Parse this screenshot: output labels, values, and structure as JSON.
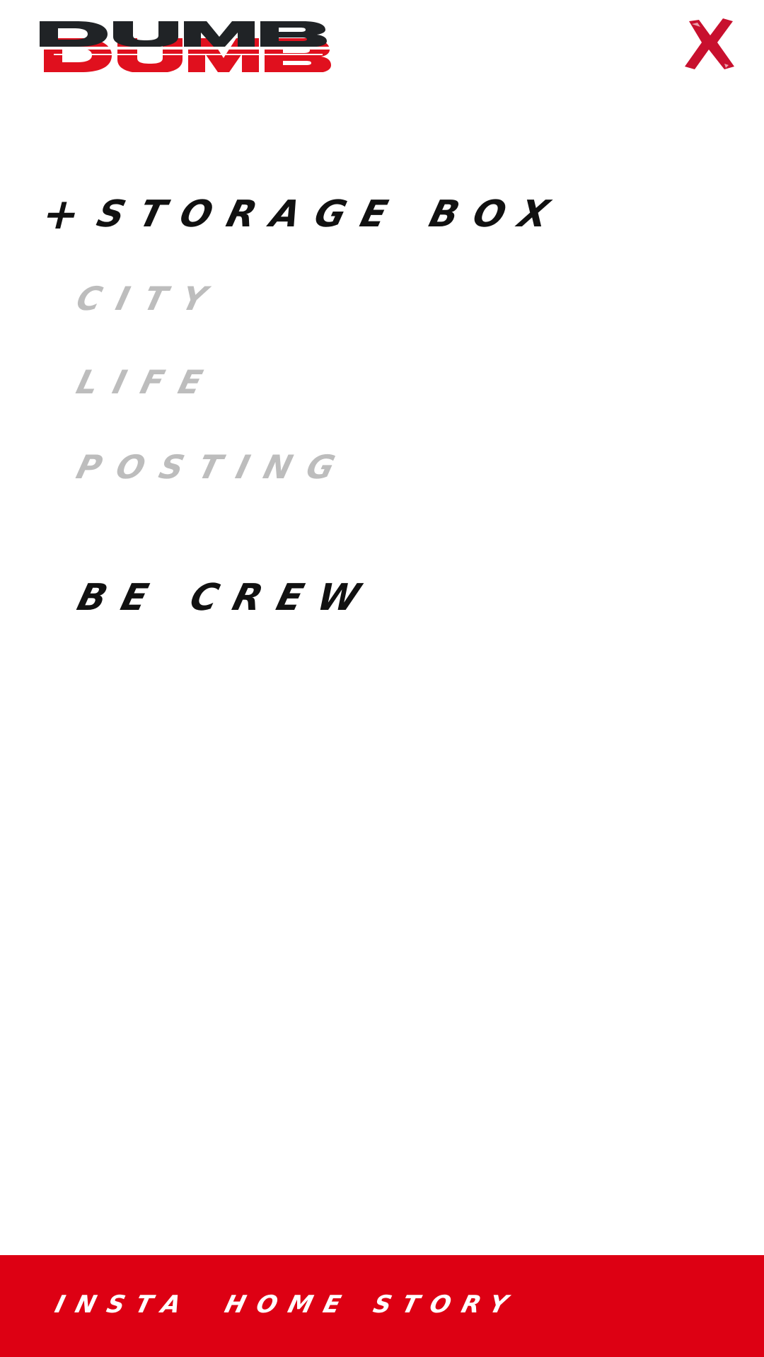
{
  "header": {
    "logo_text": "DUMB",
    "close_icon": "close-x-icon"
  },
  "menu": {
    "section": {
      "prefix": "+",
      "label": "STORAGE BOX"
    },
    "items": [
      {
        "label": "CITY"
      },
      {
        "label": "LIFE"
      },
      {
        "label": "POSTING"
      }
    ],
    "crew_label": "BE CREW"
  },
  "bottom_nav": {
    "items": [
      {
        "label": "INSTA"
      },
      {
        "label": "HOME"
      },
      {
        "label": "STORY"
      }
    ]
  },
  "colors": {
    "brand_red": "#dd0013",
    "text_dark": "#111111",
    "text_muted": "#bdbdbd",
    "close_red": "#c8102e"
  }
}
